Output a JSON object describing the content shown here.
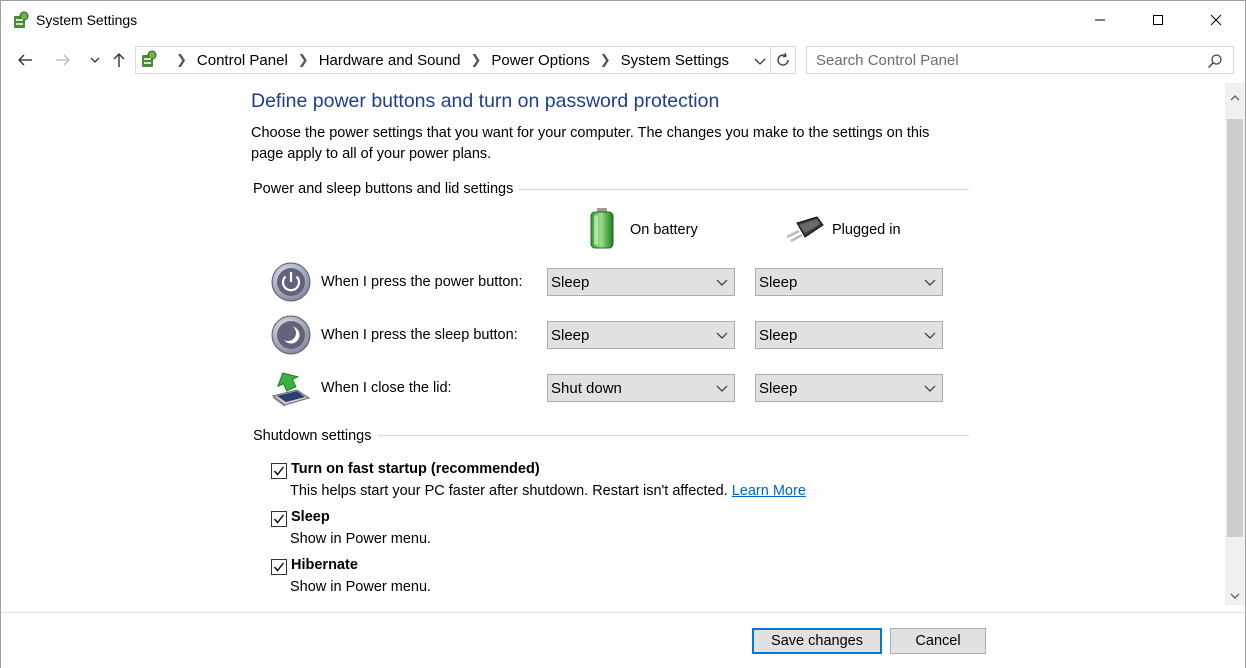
{
  "window": {
    "title": "System Settings",
    "minimize_icon": "minimize-icon",
    "maximize_icon": "maximize-icon",
    "close_icon": "close-icon"
  },
  "nav": {
    "breadcrumbs": [
      "Control Panel",
      "Hardware and Sound",
      "Power Options",
      "System Settings"
    ],
    "search_placeholder": "Search Control Panel"
  },
  "page": {
    "heading": "Define power buttons and turn on password protection",
    "intro": "Choose the power settings that you want for your computer. The changes you make to the settings on this page apply to all of your power plans."
  },
  "buttons_group": {
    "title": "Power and sleep buttons and lid settings",
    "col_battery": "On battery",
    "col_plugged": "Plugged in",
    "rows": [
      {
        "label": "When I press the power button:",
        "battery": "Sleep",
        "plugged": "Sleep",
        "icon": "power-button-icon"
      },
      {
        "label": "When I press the sleep button:",
        "battery": "Sleep",
        "plugged": "Sleep",
        "icon": "sleep-button-icon"
      },
      {
        "label": "When I close the lid:",
        "battery": "Shut down",
        "plugged": "Sleep",
        "icon": "laptop-lid-icon"
      }
    ]
  },
  "shutdown_group": {
    "title": "Shutdown settings",
    "options": [
      {
        "title": "Turn on fast startup (recommended)",
        "desc": "This helps start your PC faster after shutdown. Restart isn't affected.",
        "link": "Learn More",
        "checked": true
      },
      {
        "title": "Sleep",
        "desc": "Show in Power menu.",
        "checked": true
      },
      {
        "title": "Hibernate",
        "desc": "Show in Power menu.",
        "checked": true
      }
    ]
  },
  "footer": {
    "save": "Save changes",
    "cancel": "Cancel"
  },
  "colors": {
    "heading": "#1e3f8f",
    "link": "#0066cc",
    "accent": "#0078d7"
  }
}
